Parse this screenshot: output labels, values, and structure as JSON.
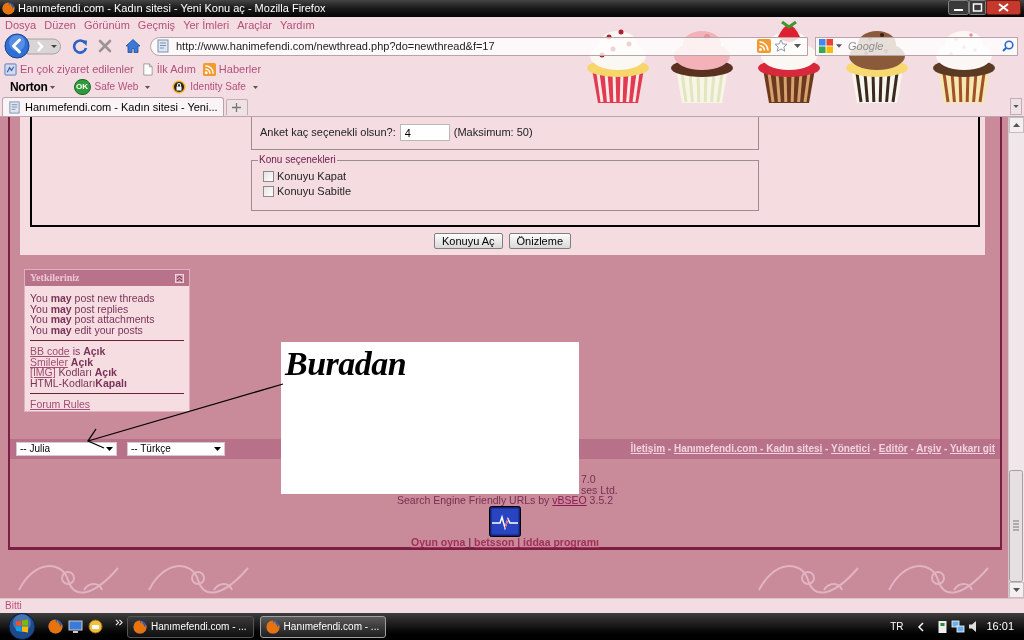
{
  "window": {
    "title": "Hanımefendi.com - Kadın sitesi - Yeni Konu aç - Mozilla Firefox"
  },
  "menu_bar": [
    "Dosya",
    "Düzen",
    "Görünüm",
    "Geçmiş",
    "Yer İmleri",
    "Araçlar",
    "Yardım"
  ],
  "address_bar": {
    "value": "http://www.hanimefendi.com/newthread.php?do=newthread&f=17"
  },
  "search_bar": {
    "placeholder": "Google"
  },
  "bookmarks": [
    {
      "kind": "smart",
      "label": "En çok ziyaret edilenler"
    },
    {
      "kind": "page",
      "label": "İlk Adım"
    },
    {
      "kind": "feed",
      "label": "Haberler"
    }
  ],
  "norton_bar": {
    "logo": "Norton",
    "items": [
      {
        "kind": "safe-web",
        "badge": "OK",
        "label": "Safe Web"
      },
      {
        "kind": "identity",
        "label": "Identity Safe"
      }
    ]
  },
  "tabs": [
    {
      "label": "Hanımefendi.com - Kadın sitesi - Yeni...",
      "selected": true
    }
  ],
  "form": {
    "poll_options": {
      "label": "Anket kaç seçenekli olsun?:",
      "value": "4",
      "hint": "(Maksimum: 50)"
    },
    "thread_options": {
      "legend": "Konu seçenekleri",
      "checkboxes": [
        {
          "label": "Konuyu Kapat",
          "checked": false
        },
        {
          "label": "Konuyu Sabitle",
          "checked": false
        }
      ]
    },
    "buttons": [
      "Konuyu Aç",
      "Önizleme"
    ]
  },
  "permissions": {
    "title": "Yetkileriniz",
    "rules": [
      "You **may** post new threads",
      "You **may** post replies",
      "You **may** post attachments",
      "You **may** edit your posts"
    ],
    "settings": [
      {
        "link": "BB code",
        "text": "is **Açık**"
      },
      {
        "link": "Smileler",
        "text": "**Açık**"
      },
      {
        "link": "[IMG]",
        "text": "Kodları **Açık**"
      },
      {
        "text": "HTML-Kodları**Kapalı**"
      }
    ],
    "footer_link": "Forum Rules"
  },
  "footer_bar": {
    "selects": [
      "-- Julia",
      "-- Türkçe"
    ],
    "separator": "-",
    "links": [
      "İletişim",
      "Hanımefendi.com - Kadın sitesi",
      "Yönetici",
      "Editör",
      "Arşiv",
      "Yukarı git"
    ]
  },
  "credits": {
    "fragments": [
      "7.0",
      "ses Ltd."
    ],
    "seo": {
      "text": "Search Engine Friendly URLs by",
      "link": "vBSEO",
      "version": "3.5.2"
    },
    "separator": "|",
    "links": [
      "Oyun oyna",
      "betsson | iddaa programı"
    ]
  },
  "annotation": {
    "text": "Buradan"
  },
  "status_bar": {
    "text": "Bitti"
  },
  "taskbar": {
    "buttons": [
      {
        "label": "Hanımefendi.com - ...",
        "selected": false
      },
      {
        "label": "Hanımefendi.com - ...",
        "selected": true
      }
    ],
    "language": "TR",
    "clock": "16:01"
  }
}
